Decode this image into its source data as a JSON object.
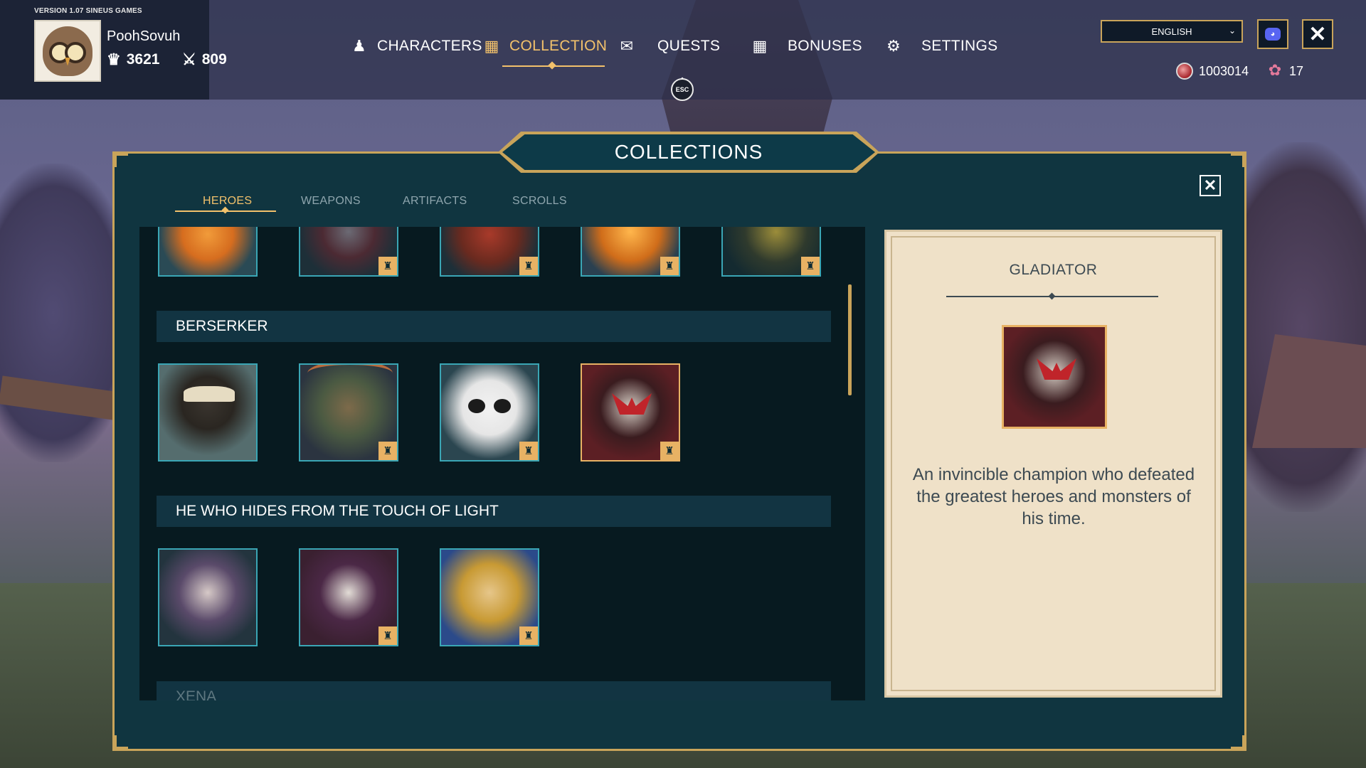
{
  "version_text": "VERSION 1.07 SINEUS GAMES",
  "profile": {
    "username": "PoohSovuh",
    "crowns": "3621",
    "swords": "809"
  },
  "nav": {
    "characters": "CHARACTERS",
    "collection": "COLLECTION",
    "quests": "QUESTS",
    "bonuses": "BONUSES",
    "settings": "SETTINGS",
    "active": "COLLECTION"
  },
  "esc_label": "ESC",
  "language": {
    "selected": "ENGLISH"
  },
  "currency": {
    "gems": "1003014",
    "petals": "17"
  },
  "panel": {
    "title": "COLLECTIONS",
    "tabs": [
      "HEROES",
      "WEAPONS",
      "ARTIFACTS",
      "SCROLLS"
    ],
    "active_tab": "HEROES"
  },
  "groups": [
    {
      "name": "",
      "heroes": [
        {
          "portrait": "tiger-hero",
          "locked": false
        },
        {
          "portrait": "wolf-hero",
          "locked": true
        },
        {
          "portrait": "red-beast-hero",
          "locked": true
        },
        {
          "portrait": "fire-tiger-hero",
          "locked": true
        },
        {
          "portrait": "masked-hero",
          "locked": true
        }
      ]
    },
    {
      "name": "BERSERKER",
      "heroes": [
        {
          "portrait": "badger-hero",
          "locked": false
        },
        {
          "portrait": "deer-hero",
          "locked": true
        },
        {
          "portrait": "panda-hero",
          "locked": true
        },
        {
          "portrait": "gladiator-hero",
          "locked": true,
          "selected": true
        }
      ]
    },
    {
      "name": "HE WHO HIDES FROM THE TOUCH OF LIGHT",
      "heroes": [
        {
          "portrait": "dark-elf-hero",
          "locked": false
        },
        {
          "portrait": "masked-elf-hero",
          "locked": true
        },
        {
          "portrait": "golden-king-hero",
          "locked": true
        }
      ]
    },
    {
      "name": "XENA",
      "heroes": []
    }
  ],
  "detail": {
    "title": "GLADIATOR",
    "description": "An invincible champion who defeated the greatest heroes and monsters of his time."
  },
  "colors": {
    "accent_gold": "#f2c16b",
    "panel_bg": "#103540",
    "card_border": "#3aa6b5",
    "selected_border": "#e8b264",
    "parchment": "#efe1c8"
  }
}
